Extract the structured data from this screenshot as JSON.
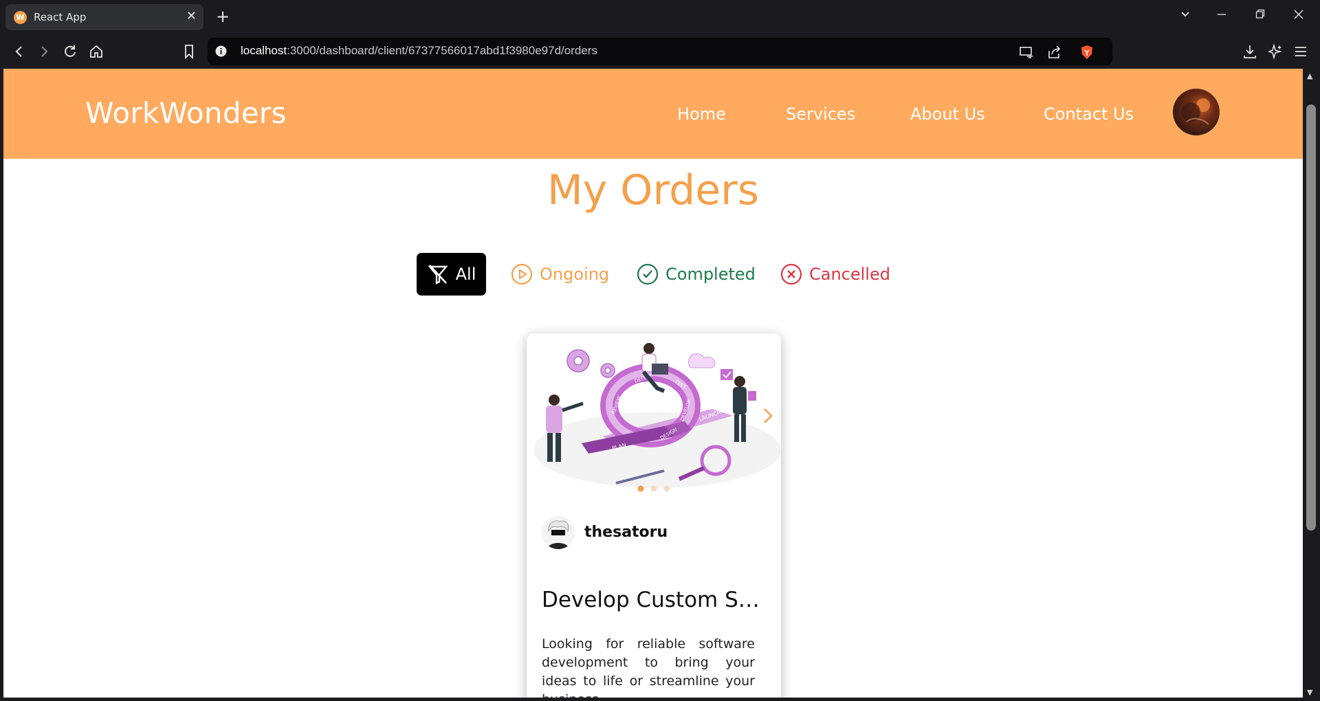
{
  "browser": {
    "tab_title": "React App",
    "tab_favicon_letter": "W",
    "url_host": "localhost",
    "url_path": ":3000/dashboard/client/67377566017abd1f3980e97d/orders"
  },
  "site": {
    "brand": "WorkWonders",
    "nav": [
      {
        "label": "Home"
      },
      {
        "label": "Services"
      },
      {
        "label": "About Us"
      },
      {
        "label": "Contact Us"
      }
    ]
  },
  "page": {
    "title": "My Orders",
    "filters": {
      "all": "All",
      "ongoing": "Ongoing",
      "completed": "Completed",
      "cancelled": "Cancelled"
    }
  },
  "colors": {
    "brand_orange": "#ffaa5e",
    "title_orange": "#f5a04b",
    "completed_green": "#1f7a4d",
    "cancelled_red": "#dc3545",
    "illustration_pink": "#c46bd0"
  },
  "orders": [
    {
      "username": "thesatoru",
      "title": "Develop Custom Soft...",
      "description": "Looking for reliable software development to bring your ideas to life or streamline your business",
      "carousel_slides": 3,
      "carousel_active": 1,
      "illustration_labels": [
        "PLAN",
        "DESIGN",
        "DEVELOP",
        "TEST",
        "DEPLOY",
        "REVIEW",
        "LAUNCH"
      ]
    }
  ]
}
